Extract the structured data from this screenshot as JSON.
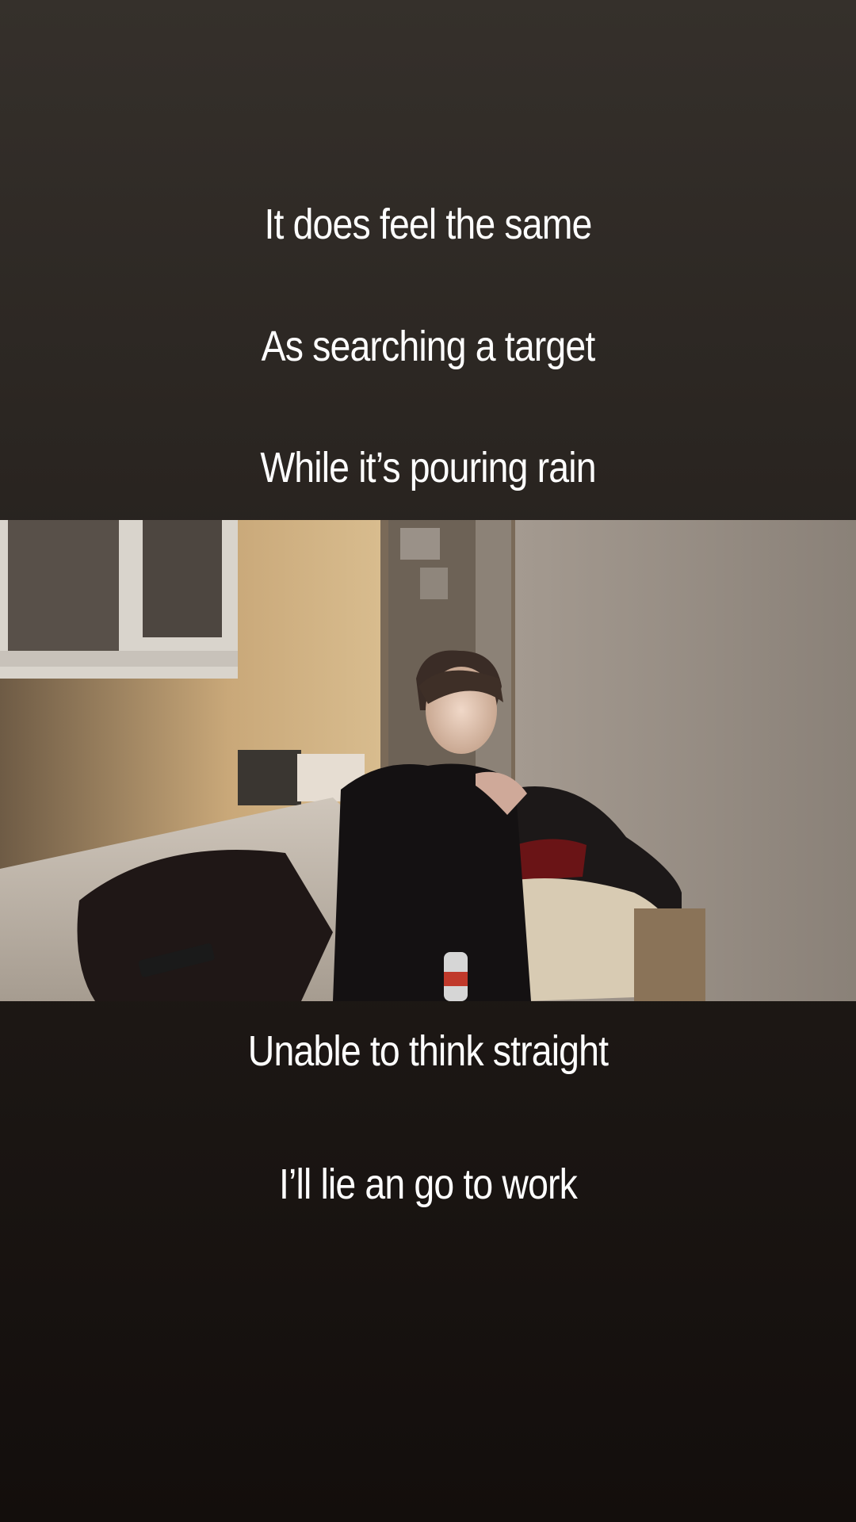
{
  "story": {
    "lyrics_top": [
      "It does feel the same",
      "As searching a target",
      "While it’s pouring rain"
    ],
    "lyrics_bottom": [
      "Unable to think straight",
      "I’ll lie an go to work"
    ]
  },
  "photo": {
    "description_icon": "room-photo"
  },
  "colors": {
    "background_top": "#35302b",
    "background_bottom": "#130e0c",
    "text": "#ffffff"
  }
}
